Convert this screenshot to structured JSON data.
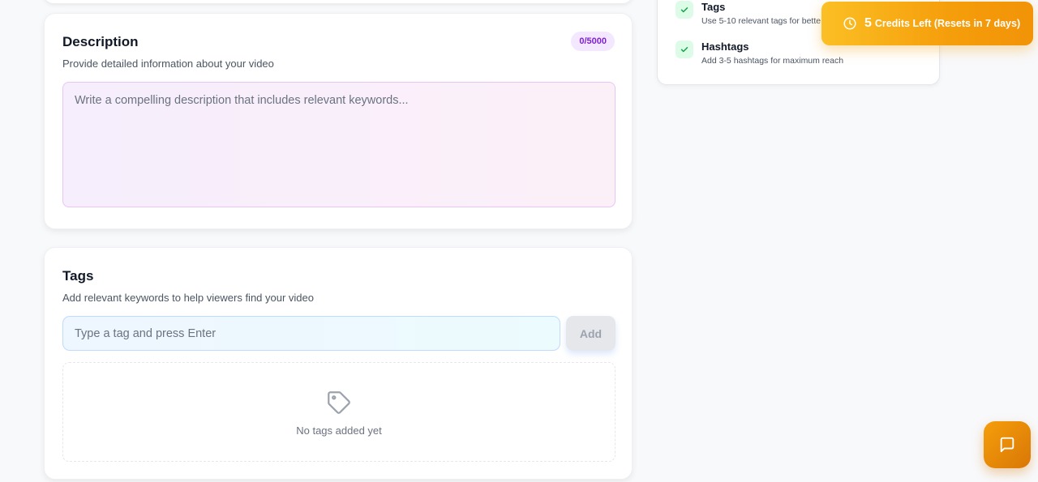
{
  "description_card": {
    "title": "Description",
    "subtitle": "Provide detailed information about your video",
    "counter": "0/5000",
    "textarea_placeholder": "Write a compelling description that includes relevant keywords..."
  },
  "tags_card": {
    "title": "Tags",
    "subtitle": "Add relevant keywords to help viewers find your video",
    "input_placeholder": "Type a tag and press Enter",
    "add_label": "Add",
    "empty_text": "No tags added yet",
    "empty_icon": "tag-icon"
  },
  "tips": [
    {
      "title": "Tags",
      "desc": "Use 5-10 relevant tags for bette",
      "icon": "check-icon"
    },
    {
      "title": "Hashtags",
      "desc": "Add 3-5 hashtags for maximum reach",
      "icon": "check-icon"
    }
  ],
  "credits": {
    "count": "5",
    "text": "Credits Left (Resets in 7 days)",
    "icon": "clock-icon"
  },
  "chat": {
    "icon": "chat-icon"
  },
  "colors": {
    "accent_orange": "#f59e0b",
    "badge_purple": "#7e22ce",
    "check_green": "#16a34a"
  }
}
